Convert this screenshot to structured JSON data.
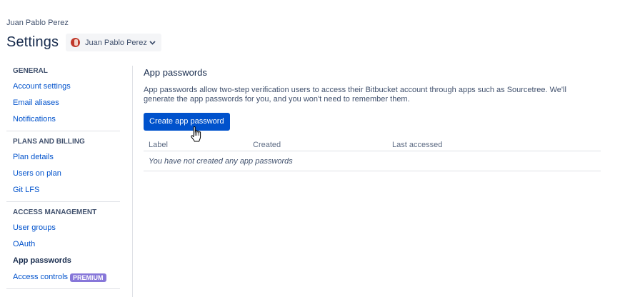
{
  "breadcrumb": "Juan Pablo Perez",
  "page_title": "Settings",
  "account_selector": {
    "name": "Juan Pablo Perez"
  },
  "sidebar": {
    "sections": [
      {
        "heading": "GENERAL",
        "items": [
          {
            "label": "Account settings"
          },
          {
            "label": "Email aliases"
          },
          {
            "label": "Notifications"
          }
        ]
      },
      {
        "heading": "PLANS AND BILLING",
        "items": [
          {
            "label": "Plan details"
          },
          {
            "label": "Users on plan"
          },
          {
            "label": "Git LFS"
          }
        ]
      },
      {
        "heading": "ACCESS MANAGEMENT",
        "items": [
          {
            "label": "User groups"
          },
          {
            "label": "OAuth"
          },
          {
            "label": "App passwords",
            "active": true
          },
          {
            "label": "Access controls",
            "badge": "PREMIUM"
          }
        ]
      }
    ]
  },
  "main": {
    "title": "App passwords",
    "description": "App passwords allow two-step verification users to access their Bitbucket account through apps such as Sourcetree. We'll generate the app passwords for you, and you won't need to remember them.",
    "create_button": "Create app password",
    "table": {
      "columns": [
        "Label",
        "Created",
        "Last accessed"
      ],
      "empty_message": "You have not created any app passwords"
    }
  },
  "colors": {
    "primary": "#0052cc",
    "badge": "#8777d9",
    "text": "#172b4d",
    "muted": "#42526e"
  }
}
